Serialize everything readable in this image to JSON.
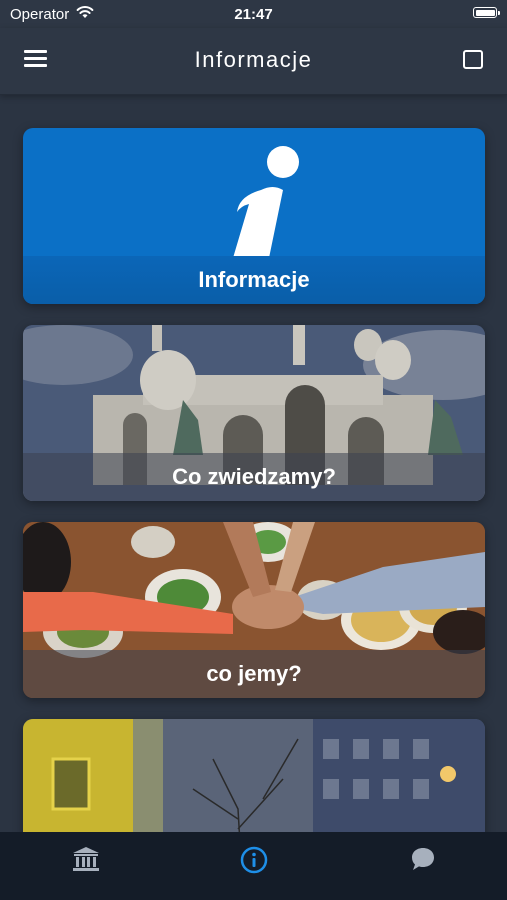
{
  "status_bar": {
    "carrier": "Operator",
    "time": "21:47"
  },
  "nav": {
    "title": "Informacje",
    "menu_icon": "hamburger-icon",
    "right_icon": "square-icon"
  },
  "cards": [
    {
      "label": "Informacje",
      "image": "info-i-icon"
    },
    {
      "label": "Co zwiedzamy?",
      "image": "basilica-photo"
    },
    {
      "label": "co jemy?",
      "image": "dinner-table-photo"
    },
    {
      "label": "",
      "image": "building-night-photo"
    }
  ],
  "tabbar": {
    "tabs": [
      {
        "icon": "museum-icon",
        "selected": false
      },
      {
        "icon": "info-circle-icon",
        "selected": true
      },
      {
        "icon": "chat-bubble-icon",
        "selected": false
      }
    ],
    "active_color": "#1e8fe8",
    "inactive_color": "#a7b0bd"
  },
  "colors": {
    "background": "#2b3442",
    "info_card": "#0b70c6"
  }
}
